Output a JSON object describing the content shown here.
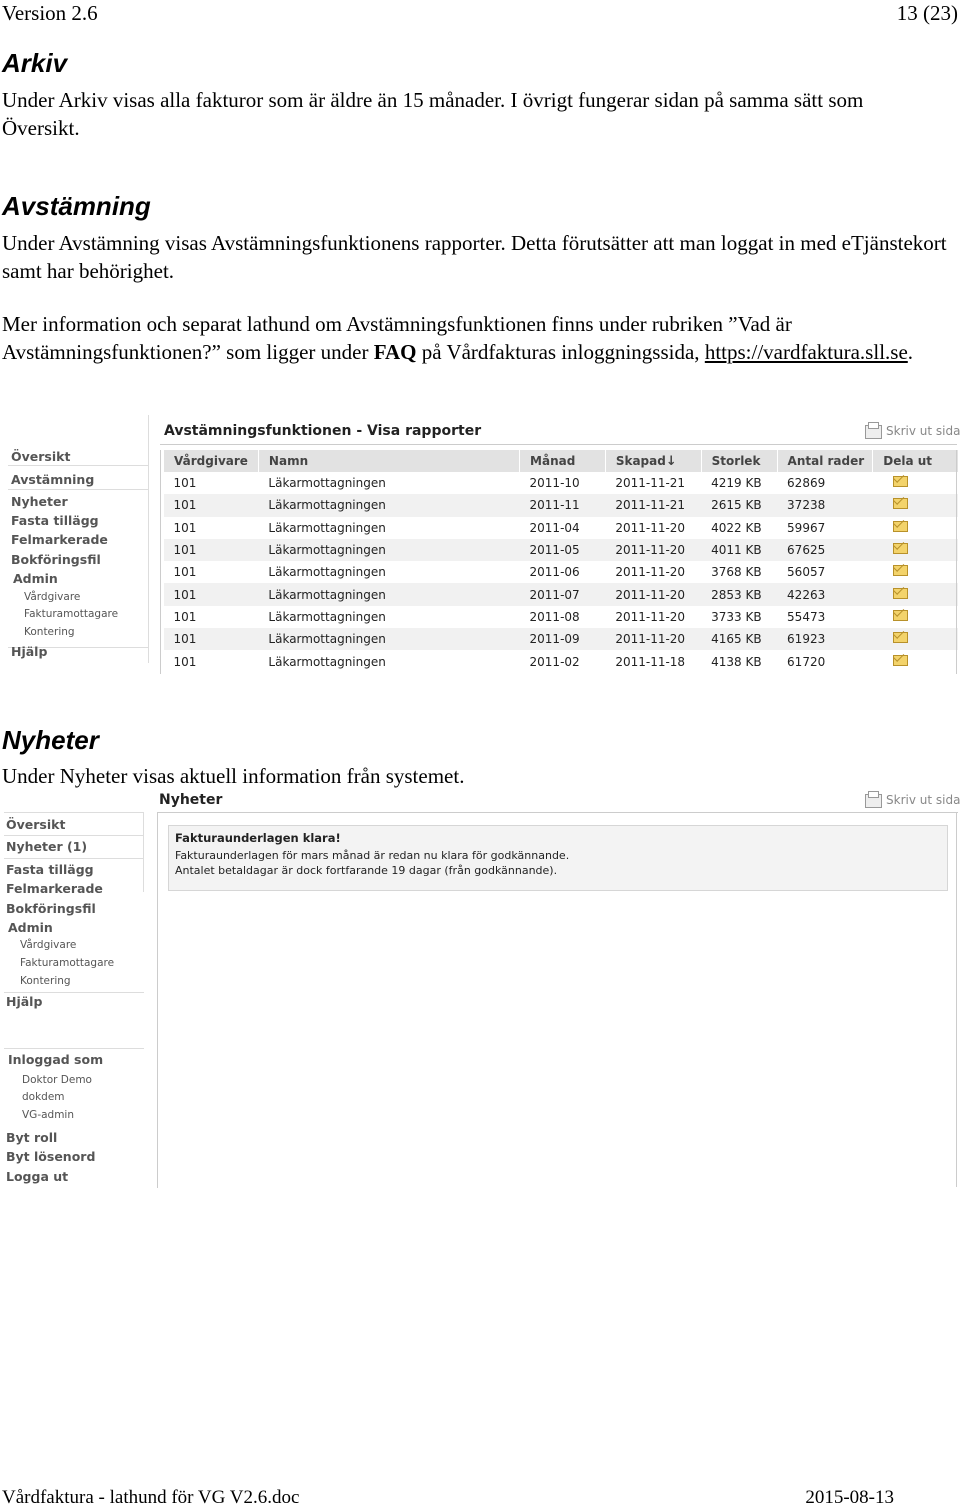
{
  "header": {
    "version": "Version 2.6",
    "page": "13 (23)"
  },
  "arkiv": {
    "heading": "Arkiv",
    "text": "Under Arkiv visas alla fakturor som är äldre än 15 månader. I övrigt fungerar sidan på samma sätt som Översikt."
  },
  "avstamning": {
    "heading": "Avstämning",
    "p1": "Under Avstämning visas Avstämningsfunktionens rapporter. Detta förutsätter att man loggat in med eTjänstekort samt har behörighet.",
    "p2_start": "Mer information och separat lathund om Avstämningsfunktionen finns under rubriken ”Vad är Avstämningsfunktionen?” som ligger under ",
    "p2_faq": "FAQ",
    "p2_mid": " på Vårdfakturas inloggningssida, ",
    "p2_link": "https://vardfaktura.sll.se",
    "p2_end": "."
  },
  "shot1": {
    "title": "Avstämningsfunktionen - Visa rapporter",
    "print": "Skriv ut sidan",
    "nav": [
      "Översikt",
      "Avstämning",
      "Nyheter",
      "Fasta tillägg",
      "Felmarkerade",
      "Bokföringsfil",
      "Admin",
      "Vårdgivare",
      "Fakturamottagare",
      "Kontering",
      "Hjälp"
    ],
    "columns": [
      "Vårdgivare",
      "Namn",
      "Månad",
      "Skapad",
      "Storlek",
      "Antal rader",
      "Dela ut"
    ],
    "sort_arrow": "↓",
    "rows": [
      [
        "101",
        "Läkarmottagningen",
        "2011-10",
        "2011-11-21",
        "4219 KB",
        "62869"
      ],
      [
        "101",
        "Läkarmottagningen",
        "2011-11",
        "2011-11-21",
        "2615 KB",
        "37238"
      ],
      [
        "101",
        "Läkarmottagningen",
        "2011-04",
        "2011-11-20",
        "4022 KB",
        "59967"
      ],
      [
        "101",
        "Läkarmottagningen",
        "2011-05",
        "2011-11-20",
        "4011 KB",
        "67625"
      ],
      [
        "101",
        "Läkarmottagningen",
        "2011-06",
        "2011-11-20",
        "3768 KB",
        "56057"
      ],
      [
        "101",
        "Läkarmottagningen",
        "2011-07",
        "2011-11-20",
        "2853 KB",
        "42263"
      ],
      [
        "101",
        "Läkarmottagningen",
        "2011-08",
        "2011-11-20",
        "3733 KB",
        "55473"
      ],
      [
        "101",
        "Läkarmottagningen",
        "2011-09",
        "2011-11-20",
        "4165 KB",
        "61923"
      ],
      [
        "101",
        "Läkarmottagningen",
        "2011-02",
        "2011-11-18",
        "4138 KB",
        "61720"
      ]
    ]
  },
  "nyheter": {
    "heading": "Nyheter",
    "text": "Under Nyheter visas aktuell information från systemet."
  },
  "shot2": {
    "title": "Nyheter",
    "print": "Skriv ut sidan",
    "nav": [
      "Översikt",
      "Nyheter (1)",
      "Fasta tillägg",
      "Felmarkerade",
      "Bokföringsfil",
      "Admin",
      "Vårdgivare",
      "Fakturamottagare",
      "Kontering",
      "Hjälp"
    ],
    "logged_in_label": "Inloggad som",
    "user": [
      "Doktor Demo",
      "dokdem",
      "VG-admin"
    ],
    "actions": [
      "Byt roll",
      "Byt lösenord",
      "Logga ut"
    ],
    "news_title": "Fakturaunderlagen klara!",
    "news_line1": "Fakturaunderlagen för mars månad är redan nu klara för godkännande.",
    "news_line2": "Antalet betaldagar är dock fortfarande 19 dagar (från godkännande)."
  },
  "footer": {
    "left": "Vårdfaktura - lathund för VG V2.6.doc",
    "right": "2015-08-13"
  }
}
